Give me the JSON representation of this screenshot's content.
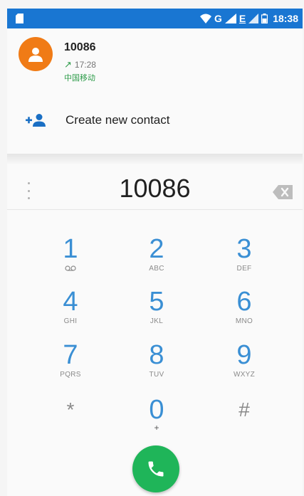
{
  "status_bar": {
    "network_g": "G",
    "network_e": "E",
    "time": "18:38",
    "colors": {
      "background": "#1976d2"
    }
  },
  "recent_call": {
    "number": "10086",
    "time": "17:28",
    "carrier": "中国移动",
    "avatar_color": "#f07b16",
    "direction_icon": "outgoing-call-arrow-icon"
  },
  "create_contact": {
    "label": "Create new contact",
    "icon": "add-person-icon"
  },
  "dialpad": {
    "digits": "10086",
    "keys": [
      {
        "num": "1",
        "letters": ""
      },
      {
        "num": "2",
        "letters": "ABC"
      },
      {
        "num": "3",
        "letters": "DEF"
      },
      {
        "num": "4",
        "letters": "GHI"
      },
      {
        "num": "5",
        "letters": "JKL"
      },
      {
        "num": "6",
        "letters": "MNO"
      },
      {
        "num": "7",
        "letters": "PQRS"
      },
      {
        "num": "8",
        "letters": "TUV"
      },
      {
        "num": "9",
        "letters": "WXYZ"
      },
      {
        "num": "*",
        "letters": ""
      },
      {
        "num": "0",
        "letters": "+"
      },
      {
        "num": "#",
        "letters": ""
      }
    ],
    "accent_color": "#3a8fd4",
    "call_button_color": "#1fb559"
  }
}
